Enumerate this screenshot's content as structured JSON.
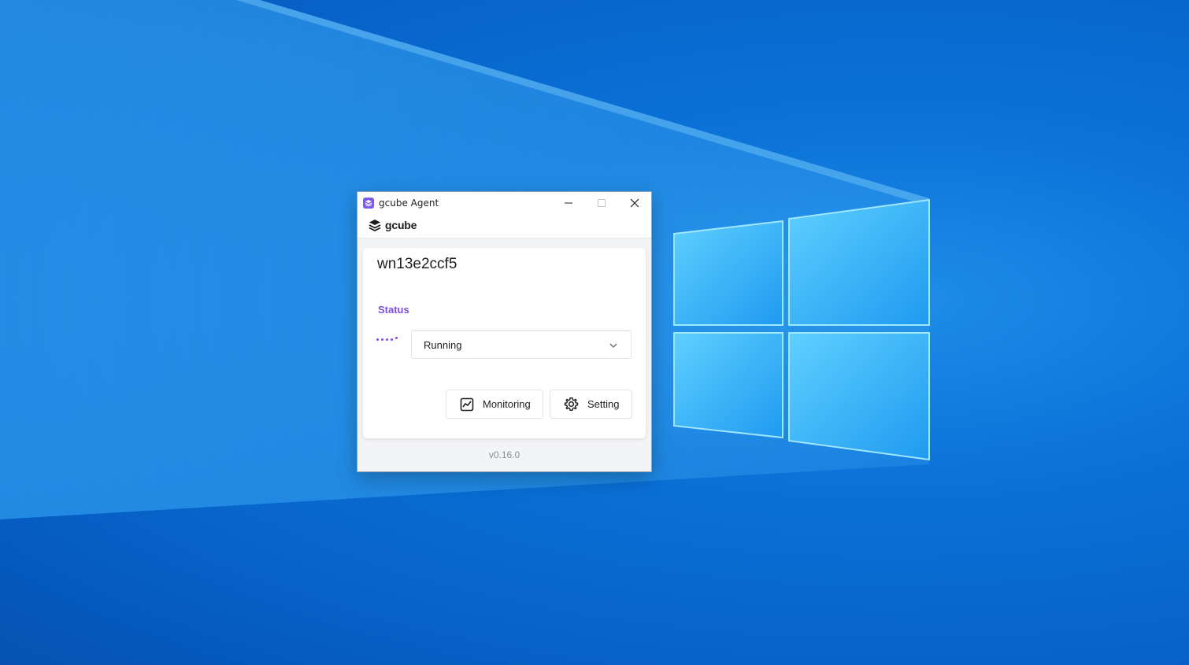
{
  "window": {
    "title": "gcube Agent",
    "brand": "gcube"
  },
  "agent": {
    "name": "wn13e2ccf5",
    "status_label": "Status",
    "status_value": "Running"
  },
  "actions": {
    "monitoring_label": "Monitoring",
    "setting_label": "Setting"
  },
  "footer": {
    "version": "v0.16.0"
  },
  "colors": {
    "accent": "#7b4fe0",
    "desktop": "#0b72d8"
  },
  "icons": {
    "app": "gcube-app-icon",
    "logo": "layers-icon",
    "dropdown": "chevron-down-icon",
    "monitoring": "chart-line-icon",
    "setting": "gear-icon",
    "minimize": "minimize-icon",
    "maximize": "maximize-icon",
    "close": "close-icon"
  }
}
